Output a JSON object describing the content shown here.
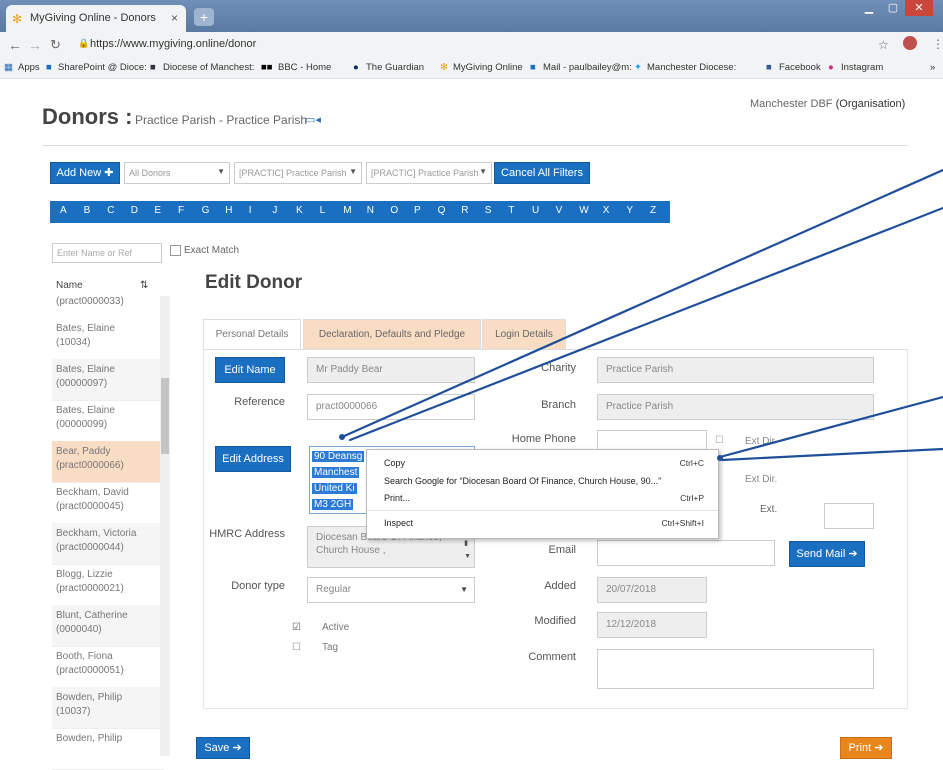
{
  "browser": {
    "tab_title": "MyGiving Online - Donors",
    "tab_close": "×",
    "new_tab": "+",
    "url": "https://www.mygiving.online/donor",
    "bookmarks": [
      "Apps",
      "SharePoint @ Dioce:",
      "Diocese of Manchest:",
      "BBC - Home",
      "The Guardian",
      "MyGiving Online",
      "Mail - paulbailey@m:",
      "Manchester Diocese:",
      "Facebook",
      "Instagram"
    ],
    "overflow": "»"
  },
  "page": {
    "title": "Donors :",
    "subtitle": "Practice Parish - Practice Parish",
    "organisation_name": "Manchester DBF",
    "organisation_type": "(Organisation)"
  },
  "filters": {
    "add_new": "Add New",
    "donor_filter": "All Donors",
    "parish_filter_1": "[PRACTIC] Practice Parish",
    "parish_filter_2": "[PRACTIC] Practice Parish",
    "cancel_filters": "Cancel All Filters",
    "search_placeholder": "Enter Name or Ref",
    "exact_match": "Exact Match"
  },
  "alphabet": [
    "A",
    "B",
    "C",
    "D",
    "E",
    "F",
    "G",
    "H",
    "I",
    "J",
    "K",
    "L",
    "M",
    "N",
    "O",
    "P",
    "Q",
    "R",
    "S",
    "T",
    "U",
    "V",
    "W",
    "X",
    "Y",
    "Z"
  ],
  "donor_list": {
    "header": "Name",
    "sort_icon": "⇅",
    "top_partial": "(pract0000033)",
    "items": [
      {
        "name": "Bates, Elaine",
        "ref": "(10034)"
      },
      {
        "name": "Bates, Elaine",
        "ref": "(00000097)"
      },
      {
        "name": "Bates, Elaine",
        "ref": "(00000099)"
      },
      {
        "name": "Bear, Paddy",
        "ref": "(pract0000066)"
      },
      {
        "name": "Beckham, David",
        "ref": "(pract0000045)"
      },
      {
        "name": "Beckham, Victoria",
        "ref": "(pract0000044)"
      },
      {
        "name": "Blogg, Lizzie",
        "ref": "(pract0000021)"
      },
      {
        "name": "Blunt, Catherine",
        "ref": "(0000040)"
      },
      {
        "name": "Booth, Fiona",
        "ref": "(pract0000051)"
      },
      {
        "name": "Bowden, Philip",
        "ref": "(10037)"
      },
      {
        "name": "Bowden, Philip",
        "ref": ""
      }
    ]
  },
  "edit": {
    "heading": "Edit Donor",
    "tabs": [
      "Personal Details",
      "Declaration, Defaults and Pledge",
      "Login Details"
    ],
    "edit_name_button": "Edit Name",
    "name_value": "Mr Paddy Bear",
    "reference_label": "Reference",
    "reference_value": "pract0000066",
    "edit_address_button": "Edit Address",
    "address_lines": [
      "90 Deansg",
      "Manchest",
      "United Ki",
      "M3 2GH"
    ],
    "hmrc_label": "HMRC Address",
    "hmrc_lines": [
      "Diocesan Board Of Finance,",
      "Church House ,"
    ],
    "donor_type_label": "Donor type",
    "donor_type_value": "Regular",
    "active_label": "Active",
    "tag_label": "Tag",
    "charity_label": "Charity",
    "charity_value": "Practice Parish",
    "branch_label": "Branch",
    "branch_value": "Practice Parish",
    "home_phone_label": "Home Phone",
    "ext_dir_label_1": "Ext Dir",
    "ext_dir_label_2": "Ext Dir.",
    "ext_label": "Ext.",
    "email_label": "Email",
    "send_mail": "Send Mail",
    "added_label": "Added",
    "added_value": "20/07/2018",
    "modified_label": "Modified",
    "modified_value": "12/12/2018",
    "comment_label": "Comment",
    "save_button": "Save",
    "print_button": "Print"
  },
  "context_menu": {
    "copy": "Copy",
    "copy_shortcut": "Ctrl+C",
    "search": "Search Google for “Diocesan Board Of Finance,  Church House,  90...”",
    "print": "Print...",
    "print_shortcut": "Ctrl+P",
    "inspect": "Inspect",
    "inspect_shortcut": "Ctrl+Shift+I"
  },
  "colors": {
    "primary": "#1a6fc1",
    "accent_orange": "#e8861c",
    "selected_row": "#f9dcc4",
    "annotation_line": "#1f4f9a"
  }
}
